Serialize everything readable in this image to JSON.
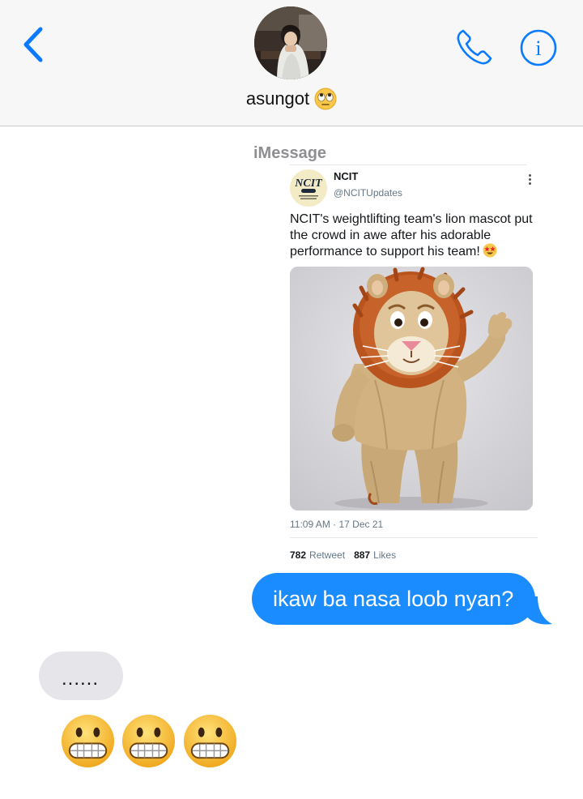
{
  "header": {
    "contact_name": "asungot",
    "name_emoji": "face-with-rolling-eyes"
  },
  "conversation": {
    "service_label": "iMessage",
    "shared_tweet": {
      "account_name": "NCIT",
      "handle": "@NCITUpdates",
      "logo_text": "NCIT",
      "text": "NCIT's weightlifting team's lion mascot put the crowd in awe after his adorable performance to support his team!",
      "text_emoji": "star-struck",
      "photo": "lion-mascot-costume",
      "timestamp": "11:09 AM · 17 Dec 21",
      "retweets": "782",
      "retweets_label": "Retweet",
      "likes": "887",
      "likes_label": "Likes"
    },
    "messages": [
      {
        "direction": "outgoing",
        "text": "ikaw ba nasa loob nyan?"
      },
      {
        "direction": "incoming",
        "text": "......"
      },
      {
        "direction": "incoming",
        "emoji": [
          "grimacing-face",
          "grimacing-face",
          "grimacing-face"
        ]
      }
    ]
  },
  "colors": {
    "ios_blue": "#1a8cff",
    "incoming_bubble": "#e5e5ea",
    "icon_blue": "#0a7aff"
  }
}
